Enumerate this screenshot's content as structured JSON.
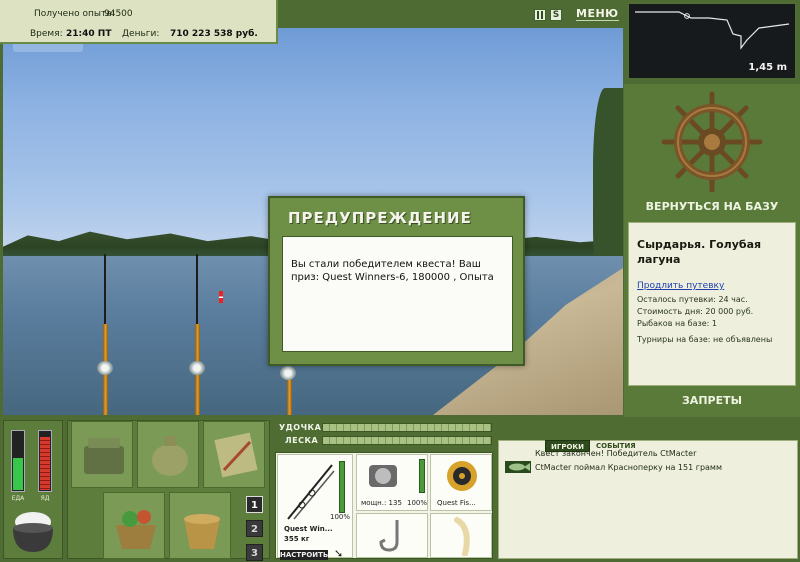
{
  "info": {
    "exp_label": "Получено опыта:",
    "exp_value": "94500",
    "time_label": "Время:",
    "time_value": "21:40 ПТ",
    "money_label": "Деньги:",
    "money_value": "710 223 538 руб."
  },
  "top_controls": {
    "pause_icon": "pause-icon",
    "sound_label": "S",
    "menu_label": "МЕНЮ"
  },
  "depth": {
    "value": "1,45 m"
  },
  "right_panel": {
    "return_label": "ВЕРНУТЬСЯ НА БАЗУ",
    "location_title": "Сырдарья. Голубая лагуна",
    "extend_link": "Продлить путевку",
    "lines": [
      "Осталось путевки: 24 час.",
      "Стоимость дня: 20 000 руб.",
      "Рыбаков на базе: 1",
      "Турниры на базе: не объявлены"
    ],
    "bans_label": "ЗАПРЕТЫ"
  },
  "dialog": {
    "title": "ПРЕДУПРЕЖДЕНИЕ",
    "body": "Вы стали победителем квеста! Ваш приз: Quest Winners-6, 180000 , Опыта"
  },
  "status_bars": {
    "food_label": "ЕДА",
    "poison_label": "ЯД",
    "food_level": 0.55,
    "poison_level": 0.92,
    "food_color": "#38c74a",
    "poison_color": "#d63a2c"
  },
  "rod_slots": {
    "numbers": [
      "1",
      "2",
      "3"
    ],
    "active": "1"
  },
  "gauges": {
    "rod_label": "УДОЧКА",
    "line_label": "ЛЕСКА"
  },
  "tackle": {
    "rod_name": "Quest Win...",
    "rod_weight": "355 кг",
    "rod_percent": "100%",
    "reel_power": "мощн.: 135",
    "reel_percent": "100%",
    "line_name": "Quest Fis...",
    "setup_label": "НАСТРОИТЬ"
  },
  "events": {
    "tab_players": "ИГРОКИ",
    "tab_events": "СОБЫТИЯ",
    "messages": [
      "Квест закончен! Победитель CtMacter",
      "CtMacter поймал Красноперку на 151 грамм"
    ]
  }
}
